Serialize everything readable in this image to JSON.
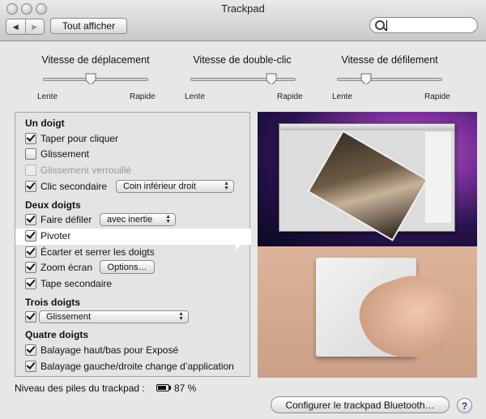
{
  "window": {
    "title": "Trackpad"
  },
  "toolbar": {
    "back_glyph": "◀",
    "forward_glyph": "▶",
    "show_all_label": "Tout afficher",
    "search_value": ""
  },
  "sliders": [
    {
      "title": "Vitesse de déplacement",
      "min_label": "Lente",
      "max_label": "Rapide",
      "value_fraction": 0.45
    },
    {
      "title": "Vitesse de double-clic",
      "min_label": "Lente",
      "max_label": "Rapide",
      "value_fraction": 0.8
    },
    {
      "title": "Vitesse de défilement",
      "min_label": "Lente",
      "max_label": "Rapide",
      "value_fraction": 0.25
    }
  ],
  "gestures": {
    "one_finger": {
      "title": "Un doigt",
      "tap_to_click": "Taper pour cliquer",
      "drag": "Glissement",
      "drag_lock": "Glissement verrouillé",
      "secondary_click": "Clic secondaire",
      "secondary_click_option": "Coin inférieur droit"
    },
    "two_fingers": {
      "title": "Deux doigts",
      "scroll": "Faire défiler",
      "scroll_option": "avec inertie",
      "rotate": "Pivoter",
      "pinch": "Écarter et serrer les doigts",
      "zoom": "Zoom écran",
      "zoom_options_button": "Options…",
      "secondary_tap": "Tape secondaire"
    },
    "three_fingers": {
      "title": "Trois doigts",
      "option": "Glissement"
    },
    "four_fingers": {
      "title": "Quatre doigts",
      "swipe_updown": "Balayage haut/bas pour Exposé",
      "swipe_leftright": "Balayage gauche/droite change d’application"
    }
  },
  "status": {
    "battery_label": "Niveau des piles du trackpad :",
    "battery_percent": "87 %",
    "battery_level": 0.87
  },
  "footer": {
    "configure_button": "Configurer le trackpad Bluetooth…",
    "help_glyph": "?"
  }
}
